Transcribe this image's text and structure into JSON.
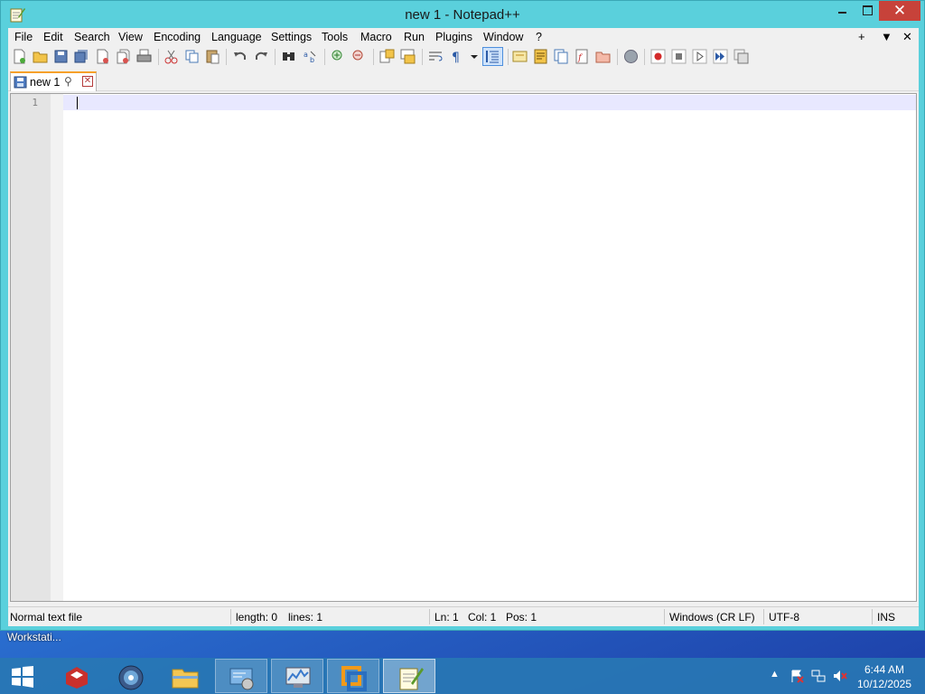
{
  "window": {
    "title": "new 1 - Notepad++",
    "close_glyph": "✕"
  },
  "menu": {
    "items": [
      "File",
      "Edit",
      "Search",
      "View",
      "Encoding",
      "Language",
      "Settings",
      "Tools",
      "Macro",
      "Run",
      "Plugins",
      "Window",
      "?"
    ],
    "right": [
      "+",
      "▼",
      "✕"
    ]
  },
  "tabs": [
    {
      "label": "new 1",
      "pin_glyph": "⚲",
      "close_glyph": "✕"
    }
  ],
  "editor": {
    "line_numbers": [
      "1"
    ],
    "content": ""
  },
  "status": {
    "file_type": "Normal text file",
    "length": "length: 0",
    "lines": "lines: 1",
    "ln": "Ln: 1",
    "col": "Col: 1",
    "pos": "Pos: 1",
    "eol": "Windows (CR LF)",
    "encoding": "UTF-8",
    "mode": "INS"
  },
  "desktop": {
    "label": "Workstati..."
  },
  "taskbar": {
    "apps": [
      "filezilla-server",
      "network-browser",
      "file-explorer",
      "control-panel",
      "performance-monitor",
      "vmware",
      "notepad-plus-plus"
    ],
    "tray_arrow": "▲",
    "time": "6:44 AM",
    "date": "10/12/2025"
  },
  "colors": {
    "titlebar": "#5ad0dc",
    "close_button": "#c7423a",
    "current_line": "#e8e8ff",
    "tab_accent": "#f6a02a"
  }
}
